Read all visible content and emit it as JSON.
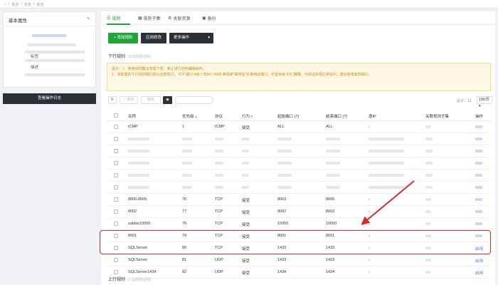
{
  "breadcrumb": [
    "安全",
    "安全",
    "安全"
  ],
  "left_panel": {
    "title": "基本属性",
    "labels": [
      "标签",
      "描述"
    ],
    "log_button": "查看操作日志"
  },
  "tabs": [
    {
      "label": "规则",
      "icon": "list-icon",
      "active": true
    },
    {
      "label": "规则子集",
      "icon": "grid-icon",
      "active": false
    },
    {
      "label": "关联资源",
      "icon": "settings-icon",
      "active": false
    },
    {
      "label": "备份",
      "icon": "camera-icon",
      "active": false
    }
  ],
  "actions": {
    "add_rule": "+ 添加规则",
    "apply_changes": "应用修改",
    "more": "更多操作"
  },
  "section": {
    "title": "下行规则",
    "subtitle": "(出站规则说明)",
    "bottom_title": "上行规则",
    "bottom_subtitle": "(入站规则说明)"
  },
  "tips": [
    "提示：1、使用规则集合管理下发，禁止进行任何编辑操作。",
    "2、未配置的下行规则端口默认全部放行。TCP 端口 445 / 3554 / 9995 等将被“禁用后”并使用此端口，可留余给 IOC 精确，为保证资源正常访问，建议使用其他端口。"
  ],
  "toolbar": {
    "refresh_icon": "refresh-icon",
    "enable": "✓ 启用",
    "delete": "删除",
    "eye_icon": "eye-icon"
  },
  "pager": {
    "total": "总计：12",
    "per_page": "100/页"
  },
  "columns": [
    "名称",
    "优先级",
    "协议",
    "行为",
    "起始端口 (?)",
    "结束端口 (?)",
    "源IP",
    "关联规则子集",
    "操作"
  ],
  "rows": [
    {
      "name": "ICMP",
      "priority": "1",
      "protocol": "ICMP",
      "action": "接受",
      "start": "ALL",
      "end": "ALL",
      "blurred": false
    },
    {
      "blurred": true
    },
    {
      "blurred": true
    },
    {
      "blurred": true
    },
    {
      "blurred": true
    },
    {
      "blurred": true
    },
    {
      "name": "8000-8005",
      "priority": "76",
      "protocol": "TCP",
      "action": "接受",
      "start": "8003",
      "end": "8005",
      "blurred": false
    },
    {
      "name": "8002",
      "priority": "77",
      "protocol": "TCP",
      "action": "接受",
      "start": "8002",
      "end": "8002",
      "blurred": false
    },
    {
      "name": "zabbix10050",
      "priority": "78",
      "protocol": "TCP",
      "action": "接受",
      "start": "10050",
      "end": "10050",
      "blurred": false
    },
    {
      "name": "8001",
      "priority": "79",
      "protocol": "TCP",
      "action": "接受",
      "start": "8001",
      "end": "8001",
      "blurred": false
    },
    {
      "name": "SQLServer",
      "priority": "80",
      "protocol": "TCP",
      "action": "接受",
      "start": "1433",
      "end": "1433",
      "blurred": false,
      "op": "启用"
    },
    {
      "name": "SQLServer",
      "priority": "81",
      "protocol": "UDP",
      "action": "接受",
      "start": "1433",
      "end": "1433",
      "blurred": false,
      "op": "启用"
    },
    {
      "name": "SQLServer1434",
      "priority": "82",
      "protocol": "UDP",
      "action": "接受",
      "start": "1434",
      "end": "1434",
      "blurred": false,
      "op": "启用"
    }
  ],
  "colors": {
    "accent": "#20a53a",
    "annotation": "#d62b2b",
    "link": "#3b7be8"
  }
}
